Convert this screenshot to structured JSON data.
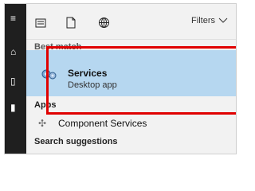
{
  "search_panel": {
    "filters_label": "Filters",
    "best_match_title": "Best match",
    "selected_result": {
      "title": "Services",
      "subtitle": "Desktop app"
    },
    "apps_title": "Apps",
    "apps": [
      {
        "label": "Component Services",
        "icon": "component-services-icon"
      }
    ],
    "suggestions_title": "Search suggestions"
  },
  "toolbar": {
    "icons": [
      "list-icon",
      "document-icon",
      "globe-icon"
    ]
  },
  "left_rail": {
    "icons": [
      "hamburger-menu-icon",
      "home-icon",
      "documents-icon",
      "user-icon"
    ]
  },
  "colors": {
    "rail_bg": "#1f1f1f",
    "panel_bg": "#f2f2f2",
    "selected_bg": "#b6d7f0",
    "highlight_border": "#e00000"
  }
}
